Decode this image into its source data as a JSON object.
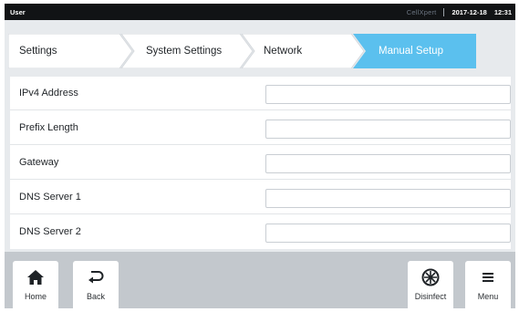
{
  "status_bar": {
    "user": "User",
    "brand": "CellXpert",
    "date": "2017-12-18",
    "time": "12:31"
  },
  "breadcrumb": {
    "items": [
      {
        "label": "Settings",
        "active": false
      },
      {
        "label": "System Settings",
        "active": false
      },
      {
        "label": "Network",
        "active": false
      },
      {
        "label": "Manual Setup",
        "active": true
      }
    ],
    "active_color": "#5bc0ee"
  },
  "form": {
    "fields": [
      {
        "label": "IPv4 Address",
        "value": ""
      },
      {
        "label": "Prefix Length",
        "value": ""
      },
      {
        "label": "Gateway",
        "value": ""
      },
      {
        "label": "DNS Server 1",
        "value": ""
      },
      {
        "label": "DNS Server 2",
        "value": ""
      }
    ]
  },
  "toolbar": {
    "home": {
      "label": "Home",
      "icon": "home-icon"
    },
    "back": {
      "label": "Back",
      "icon": "back-arrow-icon"
    },
    "disinfect": {
      "label": "Disinfect",
      "icon": "disinfect-icon"
    },
    "menu": {
      "label": "Menu",
      "icon": "menu-icon"
    }
  }
}
